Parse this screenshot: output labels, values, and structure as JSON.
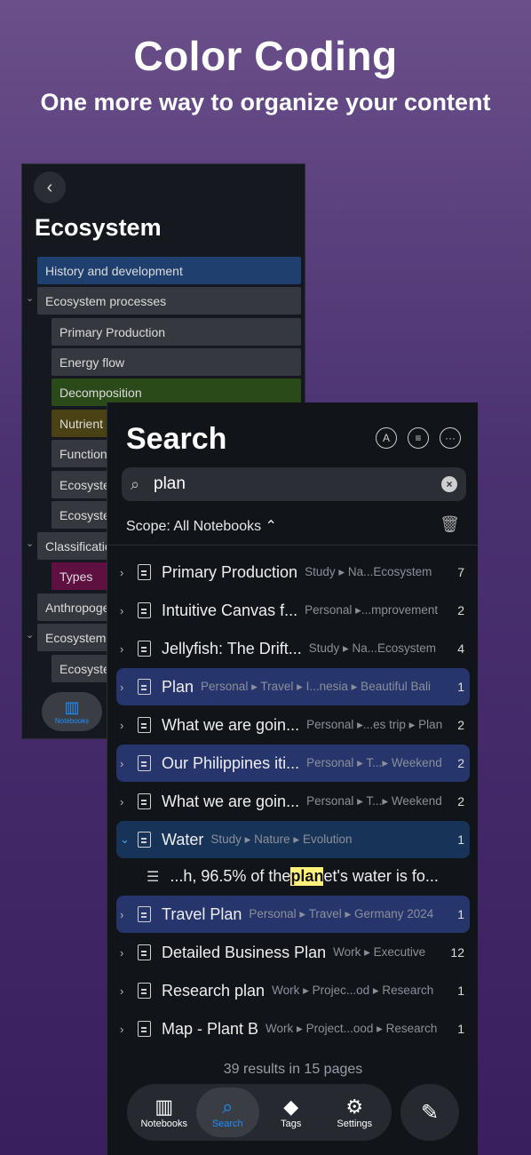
{
  "hero": {
    "title": "Color Coding",
    "subtitle": "One more way to organize your content"
  },
  "notebook": {
    "title": "Ecosystem",
    "rows": [
      {
        "label": "History and development",
        "color": "#1f3f6e"
      },
      {
        "label": "Ecosystem processes",
        "color": "#35383e"
      },
      {
        "label": "Primary Production",
        "color": "#35383e"
      },
      {
        "label": "Energy flow",
        "color": "#35383e"
      },
      {
        "label": "Decomposition",
        "color": "#2a4a1a"
      },
      {
        "label": "Nutrient",
        "color": "#4a4215"
      },
      {
        "label": "Function",
        "color": "#35383e"
      },
      {
        "label": "Ecosyste",
        "color": "#35383e"
      },
      {
        "label": "Ecosyste",
        "color": "#35383e"
      },
      {
        "label": "Classificatio",
        "color": "#35383e"
      },
      {
        "label": "Types",
        "color": "#5e1140"
      },
      {
        "label": "Anthropoge",
        "color": "#35383e"
      },
      {
        "label": "Ecosystem",
        "color": "#35383e"
      },
      {
        "label": "Ecosyste",
        "color": "#35383e"
      }
    ],
    "tab_label": "Notebooks"
  },
  "search": {
    "title": "Search",
    "query": "plan",
    "scope": "Scope: All Notebooks ⌃",
    "results": [
      {
        "title": "Primary Production",
        "path": "Study ▸ Na...Ecosystem",
        "count": "7"
      },
      {
        "title": "Intuitive Canvas f...",
        "path": "Personal ▸...mprovement",
        "count": "2"
      },
      {
        "title": "Jellyfish: The Drift...",
        "path": "Study ▸ Na...Ecosystem",
        "count": "4"
      },
      {
        "title": "Plan",
        "path": "Personal ▸ Travel ▸ I...nesia ▸ Beautiful Bali",
        "count": "1"
      },
      {
        "title": "What we are goin...",
        "path": "Personal ▸...es trip ▸ Plan",
        "count": "2"
      },
      {
        "title": "Our Philippines iti...",
        "path": "Personal ▸ T...▸ Weekend",
        "count": "2"
      },
      {
        "title": "What we are goin...",
        "path": "Personal ▸ T...▸ Weekend",
        "count": "2"
      },
      {
        "title": "Water",
        "path": "Study ▸ Nature ▸ Evolution",
        "count": "1"
      },
      {
        "title": "Travel Plan",
        "path": "Personal ▸ Travel ▸ Germany 2024",
        "count": "1"
      },
      {
        "title": "Detailed Business Plan",
        "path": "Work ▸ Executive",
        "count": "12"
      },
      {
        "title": "Research plan",
        "path": "Work ▸ Projec...od ▸ Research",
        "count": "1"
      },
      {
        "title": "Map - Plant B",
        "path": "Work ▸ Project...ood ▸ Research",
        "count": "1"
      }
    ],
    "snippet": {
      "before": "...h, 96.5% of the ",
      "match": "plan",
      "after": "et's water is fo..."
    },
    "summary": "39 results in 15 pages"
  },
  "tabs": {
    "notebooks": "Notebooks",
    "search": "Search",
    "tags": "Tags",
    "settings": "Settings"
  }
}
